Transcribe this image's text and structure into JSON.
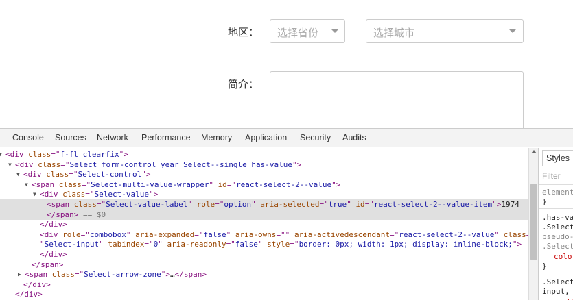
{
  "form": {
    "region_label": "地区：",
    "province_placeholder": "选择省份",
    "city_placeholder": "选择城市",
    "intro_label": "简介："
  },
  "devtools": {
    "tabs": [
      "Console",
      "Sources",
      "Network",
      "Performance",
      "Memory",
      "Application",
      "Security",
      "Audits"
    ],
    "dom_lines": [
      {
        "toggle": "▼",
        "parts": [
          [
            "tag",
            "<div "
          ],
          [
            "attr",
            "class"
          ],
          [
            "tag",
            "=\""
          ],
          [
            "val",
            "f-fl clearfix"
          ],
          [
            "tag",
            "\">"
          ]
        ]
      },
      {
        "toggle": "▼",
        "parts": [
          [
            "tag",
            "<div "
          ],
          [
            "attr",
            "class"
          ],
          [
            "tag",
            "=\""
          ],
          [
            "val",
            "Select form-control year Select--single has-value"
          ],
          [
            "tag",
            "\">"
          ]
        ]
      },
      {
        "toggle": "▼",
        "parts": [
          [
            "tag",
            "<div "
          ],
          [
            "attr",
            "class"
          ],
          [
            "tag",
            "=\""
          ],
          [
            "val",
            "Select-control"
          ],
          [
            "tag",
            "\">"
          ]
        ]
      },
      {
        "toggle": "▼",
        "parts": [
          [
            "tag",
            "<span "
          ],
          [
            "attr",
            "class"
          ],
          [
            "tag",
            "=\""
          ],
          [
            "val",
            "Select-multi-value-wrapper"
          ],
          [
            "tag",
            "\" "
          ],
          [
            "attr",
            "id"
          ],
          [
            "tag",
            "=\""
          ],
          [
            "val",
            "react-select-2--value"
          ],
          [
            "tag",
            "\">"
          ]
        ]
      },
      {
        "toggle": "▼",
        "parts": [
          [
            "tag",
            "<div "
          ],
          [
            "attr",
            "class"
          ],
          [
            "tag",
            "=\""
          ],
          [
            "val",
            "Select-value"
          ],
          [
            "tag",
            "\">"
          ]
        ]
      },
      {
        "toggle": "",
        "parts": [
          [
            "tag",
            "<span "
          ],
          [
            "attr",
            "class"
          ],
          [
            "tag",
            "=\""
          ],
          [
            "val",
            "Select-value-label"
          ],
          [
            "tag",
            "\" "
          ],
          [
            "attr",
            "role"
          ],
          [
            "tag",
            "=\""
          ],
          [
            "val",
            "option"
          ],
          [
            "tag",
            "\" "
          ],
          [
            "attr",
            "aria-selected"
          ],
          [
            "tag",
            "=\""
          ],
          [
            "val",
            "true"
          ],
          [
            "tag",
            "\" "
          ],
          [
            "attr",
            "id"
          ],
          [
            "tag",
            "=\""
          ],
          [
            "val",
            "react-select-2--value-item"
          ],
          [
            "tag",
            "\">"
          ],
          [
            "txt",
            "1974"
          ]
        ]
      },
      {
        "toggle": "",
        "parts": [
          [
            "tag",
            "</span>"
          ],
          [
            "dim",
            " == $0"
          ]
        ]
      },
      {
        "toggle": "",
        "parts": [
          [
            "tag",
            "</div>"
          ]
        ]
      },
      {
        "toggle": "",
        "parts": [
          [
            "tag",
            "<div "
          ],
          [
            "attr",
            "role"
          ],
          [
            "tag",
            "=\""
          ],
          [
            "val",
            "combobox"
          ],
          [
            "tag",
            "\" "
          ],
          [
            "attr",
            "aria-expanded"
          ],
          [
            "tag",
            "=\""
          ],
          [
            "val",
            "false"
          ],
          [
            "tag",
            "\" "
          ],
          [
            "attr",
            "aria-owns"
          ],
          [
            "tag",
            "=\"\" "
          ],
          [
            "attr",
            "aria-activedescendant"
          ],
          [
            "tag",
            "=\""
          ],
          [
            "val",
            "react-select-2--value"
          ],
          [
            "tag",
            "\" "
          ],
          [
            "attr",
            "class"
          ],
          [
            "tag",
            "="
          ]
        ]
      },
      {
        "toggle": "",
        "parts": [
          [
            "tag",
            "\""
          ],
          [
            "val",
            "Select-input"
          ],
          [
            "tag",
            "\" "
          ],
          [
            "attr",
            "tabindex"
          ],
          [
            "tag",
            "=\""
          ],
          [
            "val",
            "0"
          ],
          [
            "tag",
            "\" "
          ],
          [
            "attr",
            "aria-readonly"
          ],
          [
            "tag",
            "=\""
          ],
          [
            "val",
            "false"
          ],
          [
            "tag",
            "\" "
          ],
          [
            "attr",
            "style"
          ],
          [
            "tag",
            "=\""
          ],
          [
            "val",
            "border: 0px; width: 1px; display: inline-block;"
          ],
          [
            "tag",
            "\">"
          ]
        ]
      },
      {
        "toggle": "",
        "parts": [
          [
            "tag",
            "</div>"
          ]
        ]
      },
      {
        "toggle": "",
        "parts": [
          [
            "tag",
            "</span>"
          ]
        ]
      },
      {
        "toggle": "▶",
        "parts": [
          [
            "tag",
            "<span "
          ],
          [
            "attr",
            "class"
          ],
          [
            "tag",
            "=\""
          ],
          [
            "val",
            "Select-arrow-zone"
          ],
          [
            "tag",
            "\">"
          ],
          [
            "txt",
            "…"
          ],
          [
            "tag",
            "</span>"
          ]
        ]
      },
      {
        "toggle": "",
        "parts": [
          [
            "tag",
            "</div>"
          ]
        ]
      },
      {
        "toggle": "",
        "parts": [
          [
            "tag",
            "</div>"
          ]
        ]
      }
    ],
    "styles": {
      "tab_label": "Styles",
      "filter_placeholder": "Filter",
      "lines": [
        {
          "text": "element",
          "kind": "gray"
        },
        {
          "text": "}",
          "kind": ""
        },
        {
          "text": ".has-va",
          "kind": ""
        },
        {
          "text": ".Select",
          "kind": ""
        },
        {
          "text": "pseudo-",
          "kind": "gray"
        },
        {
          "text": ".Select",
          "kind": "gray"
        },
        {
          "text": "color",
          "kind": "prop"
        },
        {
          "text": "}",
          "kind": ""
        },
        {
          "text": ".Select",
          "kind": ""
        },
        {
          "text": "input,",
          "kind": ""
        },
        {
          "text": "-webk",
          "kind": "prop"
        }
      ]
    }
  }
}
